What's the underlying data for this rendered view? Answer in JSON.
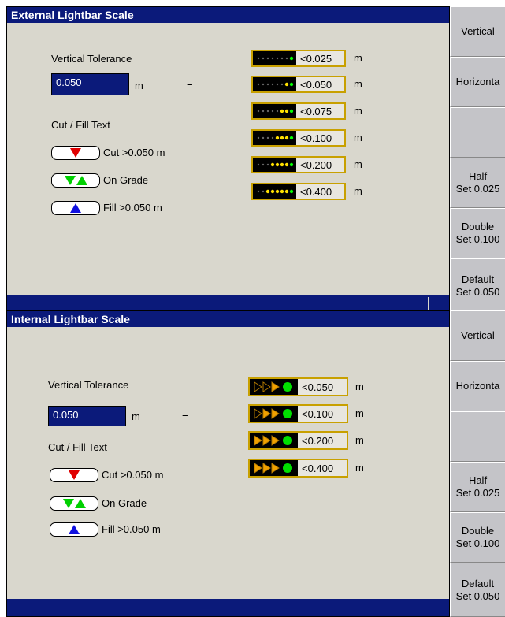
{
  "panels": [
    {
      "title": "External Lightbar Scale",
      "vertical_tolerance_label": "Vertical Tolerance",
      "tolerance_value": "0.050",
      "tolerance_unit": "m",
      "equals": "=",
      "cut_fill_label": "Cut / Fill Text",
      "cut_text": "Cut >0.050 m",
      "on_grade_text": "On Grade",
      "fill_text": "Fill >0.050 m",
      "scale_unit": "m",
      "scales": [
        "<0.025",
        "<0.050",
        "<0.075",
        "<0.100",
        "<0.200",
        "<0.400"
      ],
      "buttons": {
        "vertical": "Vertical",
        "horizontal": "Horizonta",
        "half_1": "Half",
        "half_2": "Set 0.025",
        "double_1": "Double",
        "double_2": "Set 0.100",
        "default_1": "Default",
        "default_2": "Set 0.050"
      }
    },
    {
      "title": "Internal Lightbar Scale",
      "vertical_tolerance_label": "Vertical Tolerance",
      "tolerance_value": "0.050",
      "tolerance_unit": "m",
      "equals": "=",
      "cut_fill_label": "Cut / Fill Text",
      "cut_text": "Cut >0.050 m",
      "on_grade_text": "On Grade",
      "fill_text": "Fill >0.050 m",
      "scale_unit": "m",
      "scales": [
        "<0.050",
        "<0.100",
        "<0.200",
        "<0.400"
      ],
      "buttons": {
        "vertical": "Vertical",
        "horizontal": "Horizonta",
        "half_1": "Half",
        "half_2": "Set 0.025",
        "double_1": "Double",
        "double_2": "Set 0.100",
        "default_1": "Default",
        "default_2": "Set 0.050"
      }
    }
  ],
  "colors": {
    "title_bar": "#0b1a7a",
    "window_bg": "#d9d7cd",
    "cut_red": "#e00000",
    "grade_green": "#00d000",
    "fill_blue": "#1010e0",
    "scale_border": "#c8a000"
  }
}
